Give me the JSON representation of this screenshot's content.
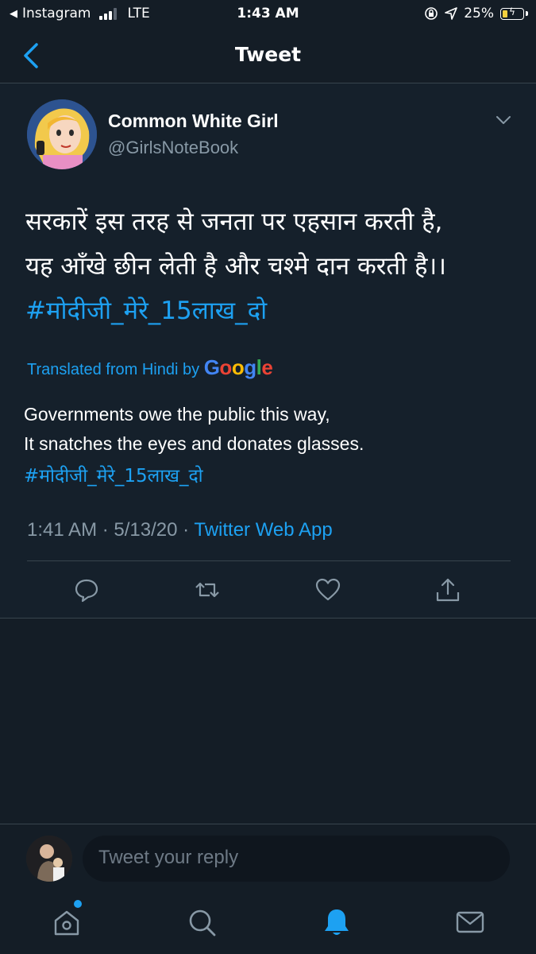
{
  "status_bar": {
    "back_app": "Instagram",
    "network": "LTE",
    "time": "1:43 AM",
    "battery_percent": "25%",
    "battery_level": 0.25
  },
  "header": {
    "title": "Tweet"
  },
  "tweet": {
    "author_name": "Common White Girl",
    "author_handle": "@GirlsNoteBook",
    "text_line1": "सरकारें इस तरह से जनता पर एहसान करती है,",
    "text_line2": "यह आँखे छीन लेती है और चश्मे दान करती है।।",
    "hashtag": "#मोदीजी_मेरे_15लाख_दो",
    "translated_label": "Translated from Hindi by",
    "translator": "Google",
    "translation_text": "Governments owe the public this way,\n It snatches the eyes and donates glasses.",
    "translation_hashtag": "#मोदीजी_मेरे_15लाख_दो",
    "timestamp": "1:41 AM · 5/13/20 ·",
    "source": "Twitter Web App"
  },
  "reply": {
    "placeholder": "Tweet your reply"
  },
  "colors": {
    "background": "#15202b",
    "accent": "#1da1f2",
    "secondary_text": "#8899a6",
    "border": "#38444d"
  },
  "icons": {
    "reply": "reply-icon",
    "retweet": "retweet-icon",
    "like": "heart-icon",
    "share": "share-icon",
    "home": "home-icon",
    "search": "search-icon",
    "notifications": "bell-icon",
    "messages": "mail-icon"
  }
}
